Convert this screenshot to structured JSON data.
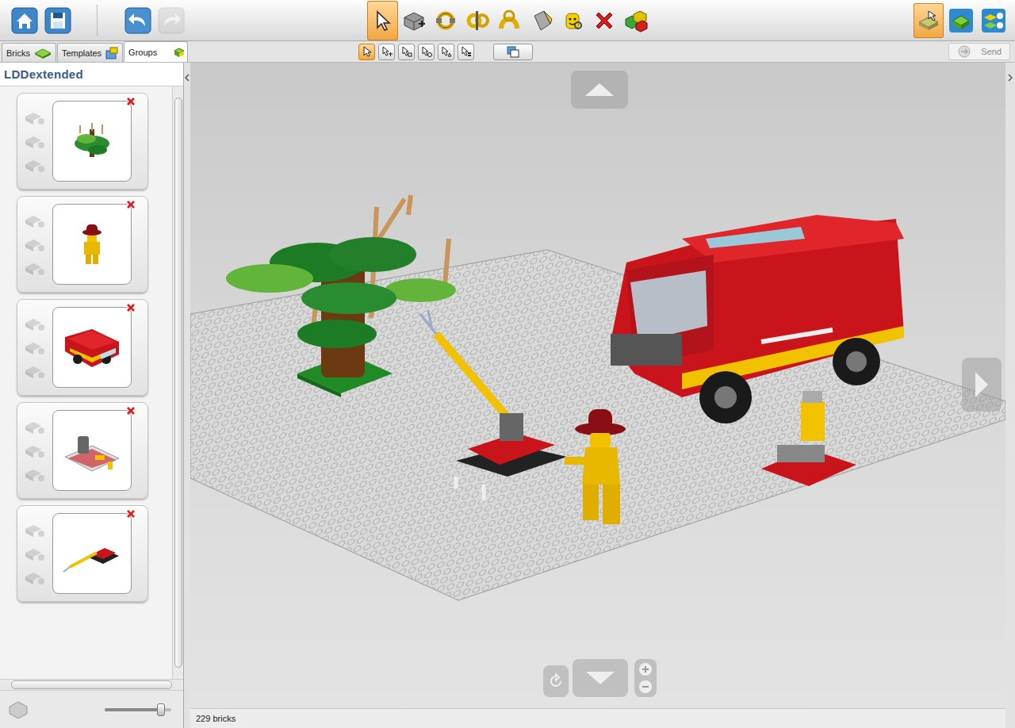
{
  "toolbar": {
    "undo_enabled": true,
    "redo_enabled": false,
    "tools": [
      {
        "selected": true
      },
      {
        "selected": false
      },
      {
        "selected": false
      },
      {
        "selected": false
      },
      {
        "selected": false
      },
      {
        "selected": false
      },
      {
        "selected": false
      },
      {
        "selected": false
      },
      {
        "selected": false
      }
    ],
    "view_modes": [
      {
        "selected": true
      },
      {
        "selected": false
      },
      {
        "selected": false
      }
    ]
  },
  "tabs": [
    {
      "label": "Bricks",
      "selected": false
    },
    {
      "label": "Templates",
      "selected": false
    },
    {
      "label": "Groups",
      "selected": true
    }
  ],
  "select_modes": [
    {
      "selected": true
    },
    {
      "selected": false
    },
    {
      "selected": false
    },
    {
      "selected": false
    },
    {
      "selected": false
    },
    {
      "selected": false
    }
  ],
  "send": {
    "label": "Send",
    "disabled": true
  },
  "panel": {
    "title": "LDDextended"
  },
  "groups": [
    {
      "actions_disabled": true
    },
    {
      "actions_disabled": true
    },
    {
      "actions_disabled": true
    },
    {
      "actions_disabled": true
    },
    {
      "actions_disabled": true
    }
  ],
  "zoom": {
    "level": 0.85
  },
  "status_bar": {
    "count": "229 bricks"
  }
}
